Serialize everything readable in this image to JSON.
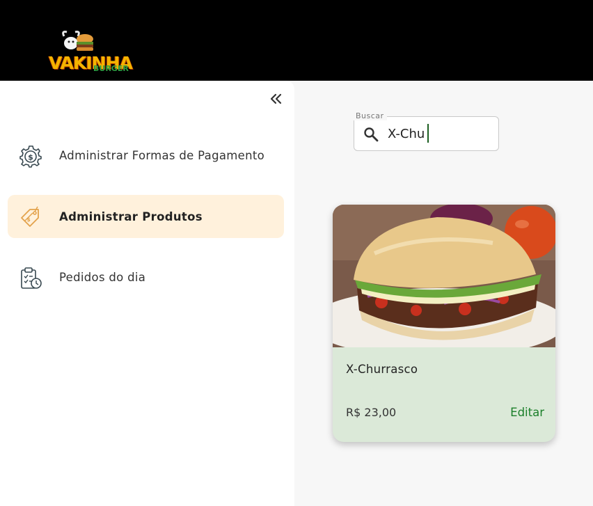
{
  "brand": {
    "name": "VAKINHA",
    "sub": "BURGER"
  },
  "sidebar": {
    "collapse_icon": "double-chevron-left-icon",
    "items": [
      {
        "label": "Administrar Formas de Pagamento",
        "icon": "payment-gear-icon",
        "active": false
      },
      {
        "label": "Administrar Produtos",
        "icon": "price-tag-icon",
        "active": true
      },
      {
        "label": "Pedidos do dia",
        "icon": "clipboard-clock-icon",
        "active": false
      }
    ]
  },
  "search": {
    "label": "Buscar",
    "value": "X-Chu",
    "icon": "search-icon"
  },
  "products": [
    {
      "name": "X-Churrasco",
      "price": "R$ 23,00",
      "action": "Editar"
    }
  ],
  "colors": {
    "active_bg": "#fff1dc",
    "card_bg": "#dbe9d8",
    "edit_link": "#1b7f2a",
    "topbar": "#000000"
  }
}
